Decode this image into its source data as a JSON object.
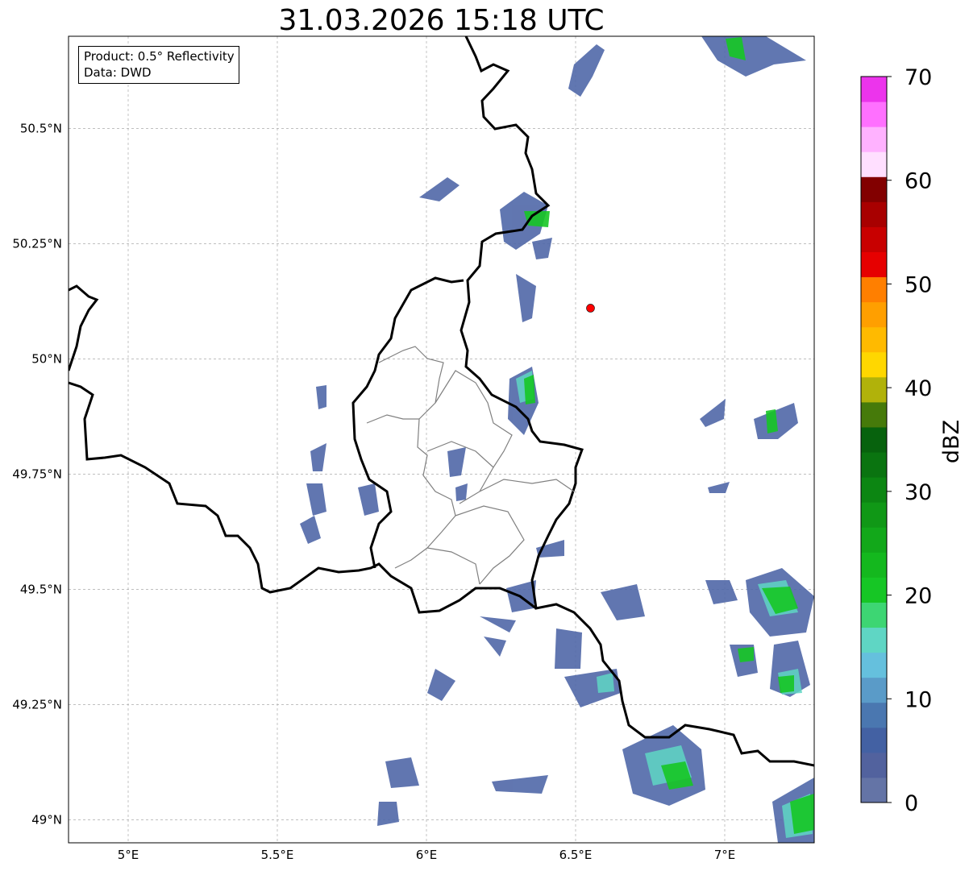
{
  "title": "31.03.2026 15:18 UTC",
  "info": {
    "product_line": "Product: 0.5° Reflectivity",
    "data_line": "Data: DWD"
  },
  "map": {
    "lon_range": [
      4.8,
      7.3
    ],
    "lat_range": [
      48.95,
      50.7
    ],
    "x_ticks": [
      {
        "value": 5.0,
        "label": "5°E"
      },
      {
        "value": 5.5,
        "label": "5.5°E"
      },
      {
        "value": 6.0,
        "label": "6°E"
      },
      {
        "value": 6.5,
        "label": "6.5°E"
      },
      {
        "value": 7.0,
        "label": "7°E"
      }
    ],
    "y_ticks": [
      {
        "value": 50.5,
        "label": "50.5°N"
      },
      {
        "value": 50.25,
        "label": "50.25°N"
      },
      {
        "value": 50.0,
        "label": "50°N"
      },
      {
        "value": 49.75,
        "label": "49.75°N"
      },
      {
        "value": 49.5,
        "label": "49.5°N"
      },
      {
        "value": 49.25,
        "label": "49.25°N"
      },
      {
        "value": 49.0,
        "label": "49°N"
      }
    ],
    "station_marker": {
      "lon": 6.55,
      "lat": 50.11,
      "color": "#ff0000"
    },
    "grid": "dashed"
  },
  "colorbar": {
    "label": "dBZ",
    "min": 0,
    "max": 70,
    "tick_labels": [
      "0",
      "10",
      "20",
      "30",
      "40",
      "50",
      "60",
      "70"
    ],
    "colors": [
      "#6474a6",
      "#52629e",
      "#4361a3",
      "#4a77b0",
      "#5a9bc8",
      "#65c0dd",
      "#5fd6c4",
      "#3dd673",
      "#16c625",
      "#14b81e",
      "#12a81a",
      "#109816",
      "#0c8612",
      "#0a7410",
      "#07620d",
      "#467a0a",
      "#b1b20a",
      "#ffd700",
      "#ffba00",
      "#ff9f00",
      "#ff7f00",
      "#e60000",
      "#c80000",
      "#a80000",
      "#820000",
      "#ffdfff",
      "#ffb2ff",
      "#ff70ff",
      "#ec34ec"
    ]
  }
}
